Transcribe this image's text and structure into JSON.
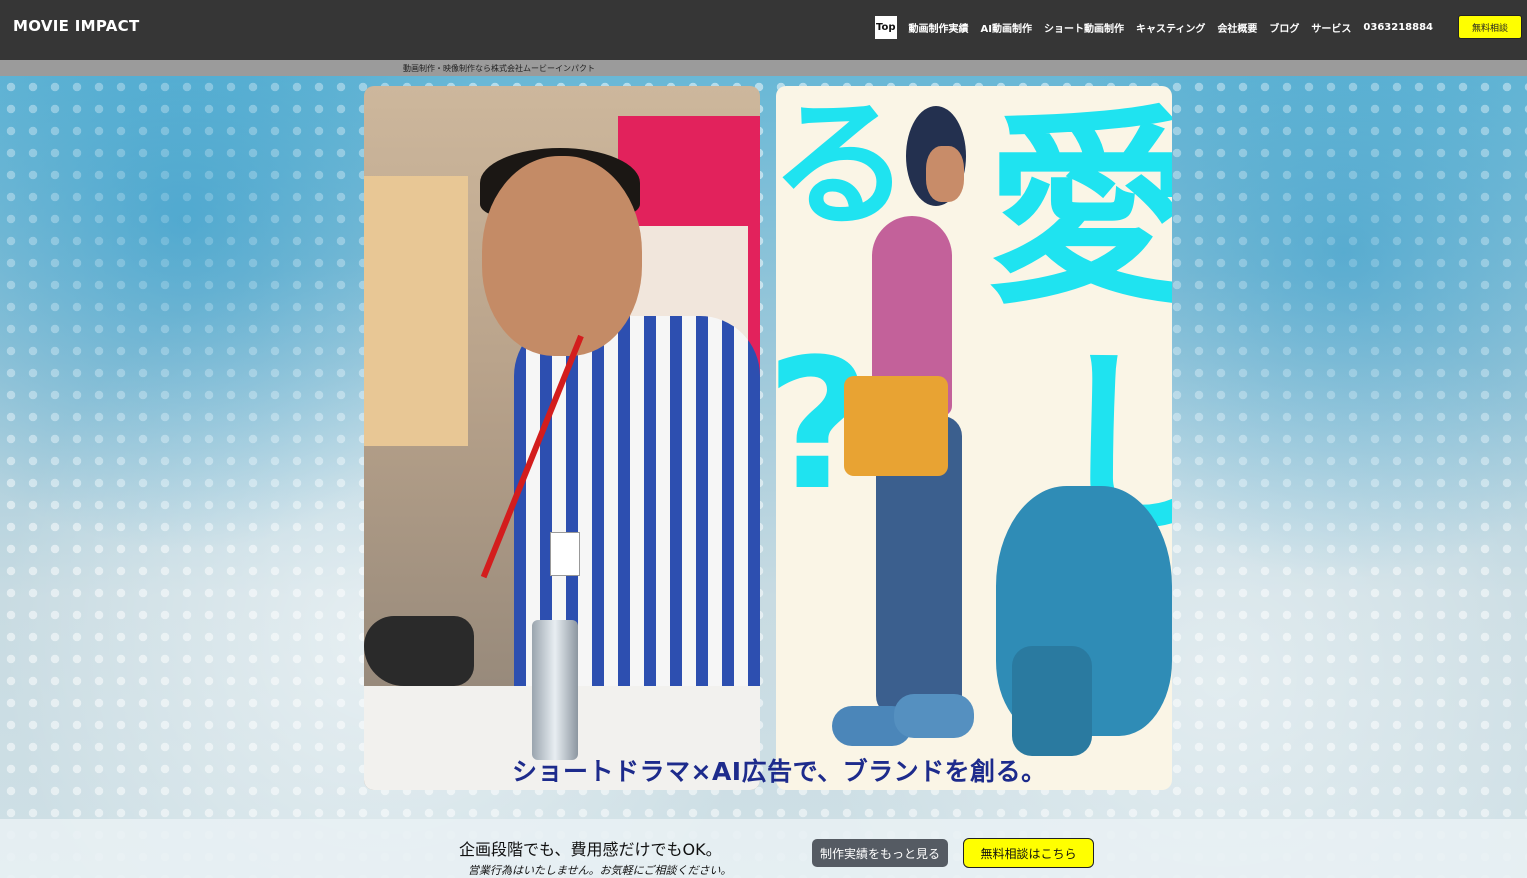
{
  "header": {
    "logo": "MOVIE IMPACT",
    "nav": [
      {
        "label": "Top",
        "active": true
      },
      {
        "label": "動画制作実績"
      },
      {
        "label": "AI動画制作"
      },
      {
        "label": "ショート動画制作"
      },
      {
        "label": "キャスティング"
      },
      {
        "label": "会社概要"
      },
      {
        "label": "ブログ"
      },
      {
        "label": "サービス"
      },
      {
        "label": "0363218884"
      }
    ],
    "cta": "無料相談"
  },
  "breadcrumb": "動画制作・映像制作なら株式会社ムービーインパクト",
  "hero": {
    "tagline": "ショートドラマ×AI広告で、ブランドを創る。",
    "right_card_glyphs": [
      "愛",
      "る",
      "?",
      "し"
    ]
  },
  "bottom_bar": {
    "main": "企画段階でも、費用感だけでもOK。",
    "sub": "営業行為はいたしません。お気軽にご相談ください。",
    "works_button": "制作実績をもっと見る",
    "consult_button": "無料相談はこちら"
  },
  "colors": {
    "header_bg": "#363636",
    "accent_yellow": "#ffff00",
    "tagline_navy": "#1d2b8c",
    "glyph_cyan": "#1fe3f0"
  }
}
